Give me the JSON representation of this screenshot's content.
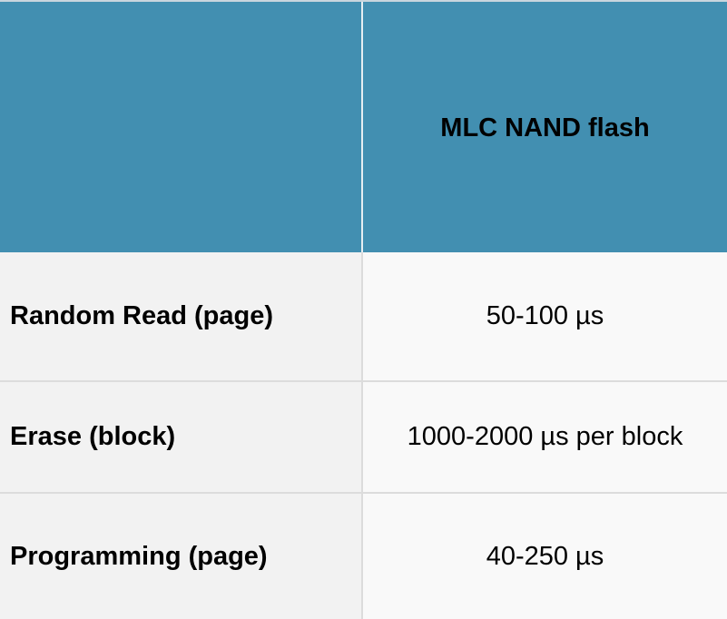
{
  "table": {
    "header": {
      "corner": "",
      "column": "MLC NAND flash"
    },
    "rows": [
      {
        "label": "Random Read (page)",
        "value": "50-100 µs"
      },
      {
        "label": "Erase (block)",
        "value": "1000-2000 µs per block"
      },
      {
        "label": "Programming (page)",
        "value": "40-250 µs"
      }
    ]
  },
  "colors": {
    "header_bg": "#428fb1",
    "label_bg": "#f2f2f2",
    "value_bg": "#f9f9f9",
    "grid": "#dcdcdc"
  }
}
